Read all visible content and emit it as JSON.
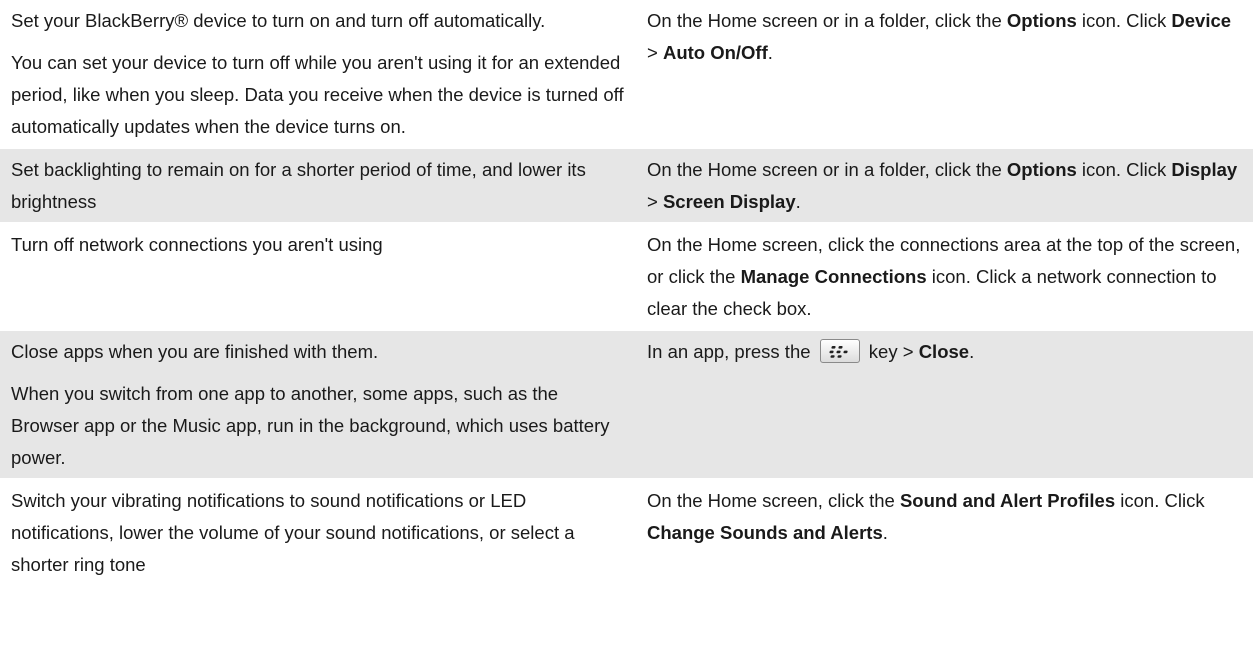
{
  "rows": [
    {
      "shaded": false,
      "tip": [
        "Set your BlackBerry® device to turn on and turn off automatically.",
        "You can set your device to turn off while you aren't using it for an extended period, like when you sleep. Data you receive when the device is turned off automatically updates when the device turns on."
      ],
      "how": {
        "t1": "On the Home screen or in a folder, click the ",
        "b1": "Options",
        "t2": " icon. Click ",
        "b2": "Device",
        "t3": " > ",
        "b3": "Auto On/Off",
        "t4": "."
      }
    },
    {
      "shaded": true,
      "tip": [
        "Set backlighting to remain on for a shorter period of time, and lower its brightness"
      ],
      "how": {
        "t1": "On the Home screen or in a folder, click the ",
        "b1": "Options",
        "t2": " icon. Click ",
        "b2": "Display",
        "t3": " > ",
        "b3": "Screen Display",
        "t4": "."
      }
    },
    {
      "shaded": false,
      "tip": [
        "Turn off network connections you aren't using"
      ],
      "how": {
        "t1": "On the Home screen, click the connections area at the top of the screen, or click the ",
        "b1": "Manage Connections",
        "t2": " icon. Click a network connection to clear the check box."
      }
    },
    {
      "shaded": true,
      "tip": [
        "Close apps when you are finished with them.",
        "When you switch from one app to another, some apps, such as the Browser app or the Music app, run in the background, which uses battery power."
      ],
      "how": {
        "t1": "In an app, press the ",
        "t2": " key > ",
        "b1": "Close",
        "t3": "."
      }
    },
    {
      "shaded": false,
      "tip": [
        "Switch your vibrating notifications to sound notifications or LED notifications, lower the volume of your sound notifications, or select a shorter ring tone"
      ],
      "how": {
        "t1": "On the Home screen, click the ",
        "b1": "Sound and Alert Profiles",
        "t2": " icon. Click ",
        "b2": "Change Sounds and Alerts",
        "t3": "."
      }
    }
  ],
  "icons": {
    "menu_key": "blackberry-menu-key-icon"
  }
}
